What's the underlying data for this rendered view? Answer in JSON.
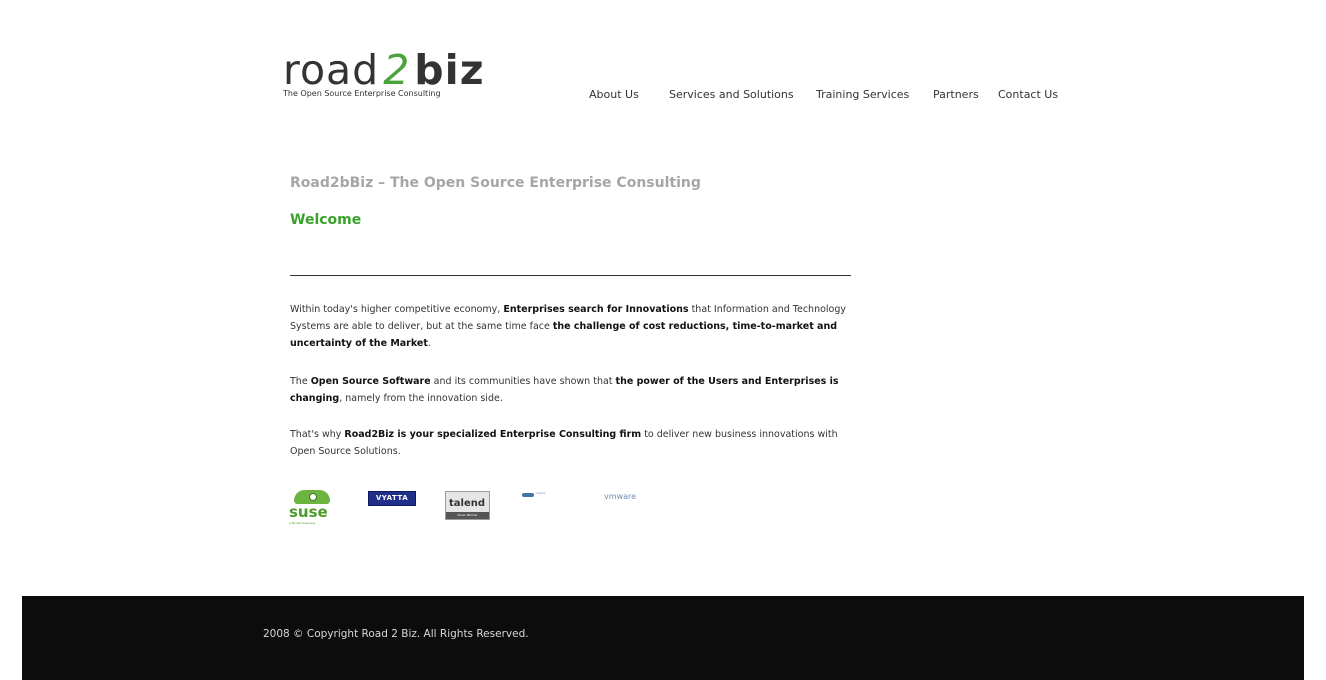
{
  "logo": {
    "road": "road",
    "two": "2",
    "biz": "biz",
    "tagline": "The Open Source Enterprise Consulting"
  },
  "nav": {
    "items": [
      {
        "label": "About Us"
      },
      {
        "label": "Services and Solutions"
      },
      {
        "label": "Training Services"
      },
      {
        "label": "Partners"
      },
      {
        "label": "Contact Us"
      }
    ]
  },
  "main": {
    "page_title": "Road2bBiz – The Open Source Enterprise Consulting",
    "welcome": "Welcome",
    "p1": {
      "t1": "Within today's higher competitive economy, ",
      "b1": "Enterprises search for Innovations",
      "t2": " that Information and Technology Systems are able to deliver, but at the same time face ",
      "b2": "the challenge of cost reductions, time-to-market and uncertainty of the Market",
      "t3": "."
    },
    "p2": {
      "t1": "The ",
      "b1": "Open Source Software",
      "t2": " and its communities have shown that ",
      "b2": "the power of the Users and Enterprises is changing",
      "t3": ", namely from the innovation side."
    },
    "p3": {
      "t1": "That's why ",
      "b1": "Road2Biz is your specialized Enterprise Consulting firm",
      "t2": " to deliver new business innovations with Open Source Solutions."
    }
  },
  "partners": {
    "suse": "suse",
    "suse_sub": "a Novell business",
    "vyatta": "VYATTA",
    "talend": "talend",
    "talend_sub": "Silver Partner",
    "ingres": "Ingres",
    "vmware": "vmware"
  },
  "footer": {
    "copyright": "2008 © Copyright Road 2 Biz. All Rights Reserved."
  },
  "colors": {
    "accent_green": "#38a22b",
    "title_gray": "#a6a6a6",
    "footer_bg": "#0c0c0c"
  }
}
